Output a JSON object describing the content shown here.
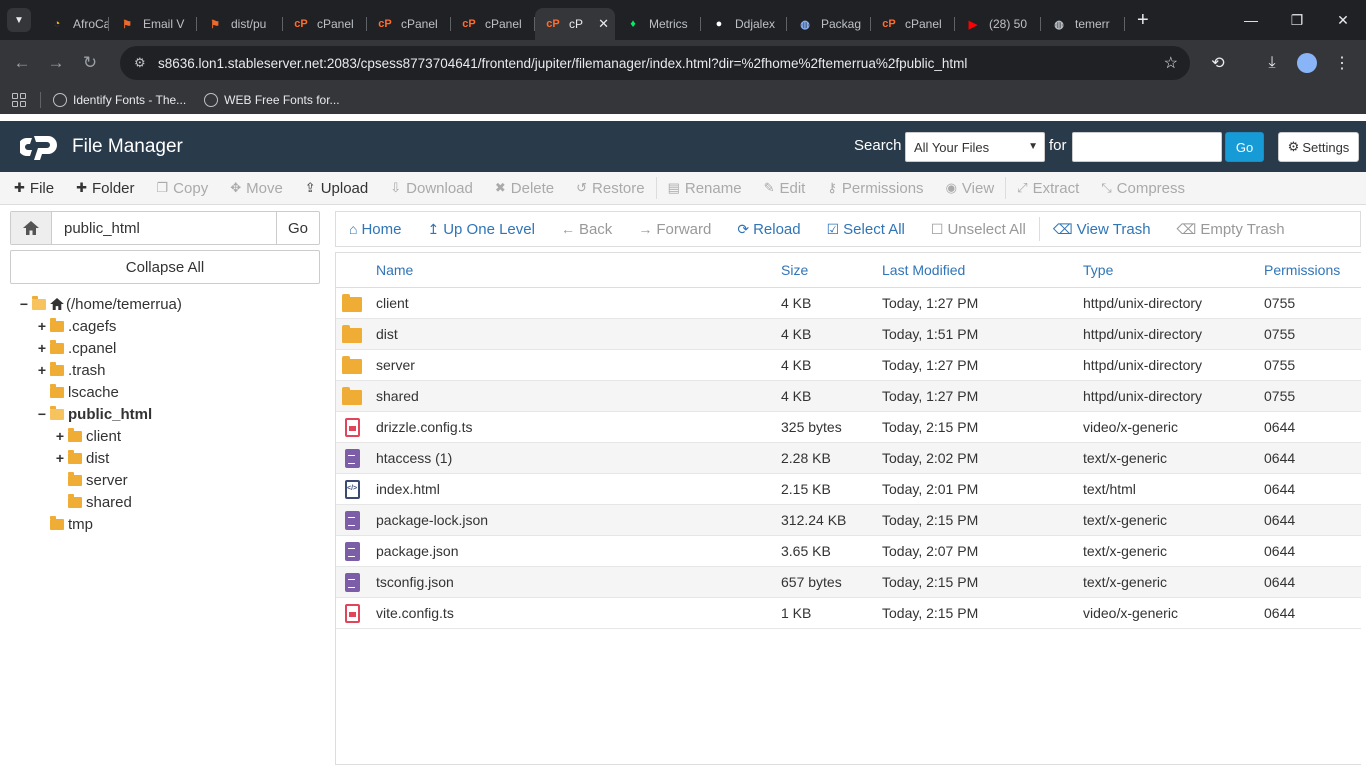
{
  "browser": {
    "tabs": [
      {
        "title": "AfroCa",
        "favicon": "afrocash-icon",
        "color": "#f5b400"
      },
      {
        "title": "Email V",
        "favicon": "git-icon",
        "color": "#f0692a"
      },
      {
        "title": "dist/pu",
        "favicon": "git-icon",
        "color": "#f0692a"
      },
      {
        "title": "cPanel",
        "favicon": "cpanel-icon",
        "color": "#ff6c2c"
      },
      {
        "title": "cPanel",
        "favicon": "cpanel-icon",
        "color": "#ff6c2c"
      },
      {
        "title": "cPanel",
        "favicon": "cpanel-icon",
        "color": "#ff6c2c"
      },
      {
        "title": "cP",
        "favicon": "cpanel-icon",
        "color": "#ff6c2c",
        "active": true
      },
      {
        "title": "Metrics",
        "favicon": "mongodb-leaf-icon",
        "color": "#00ed64"
      },
      {
        "title": "Ddjalex",
        "favicon": "github-icon",
        "color": "#ffffff"
      },
      {
        "title": "Packag",
        "favicon": "globe-icon",
        "color": "#8ab4f8"
      },
      {
        "title": "cPanel",
        "favicon": "cpanel-icon",
        "color": "#ff6c2c"
      },
      {
        "title": "(28) 50",
        "favicon": "youtube-icon",
        "color": "#ff0000"
      },
      {
        "title": "temerr",
        "favicon": "globe-icon",
        "color": "#bdc1c6"
      }
    ],
    "url": "s8636.lon1.stableserver.net:2083/cpsess8773704641/frontend/jupiter/filemanager/index.html?dir=%2fhome%2ftemerrua%2fpublic_html",
    "bookmarks": [
      {
        "label": "Identify Fonts - The..."
      },
      {
        "label": "WEB Free Fonts for..."
      }
    ]
  },
  "header": {
    "title": "File Manager",
    "search_label": "Search",
    "search_scope": "All Your Files",
    "for_label": "for",
    "search_value": "",
    "go_label": "Go",
    "settings_label": "Settings"
  },
  "actions": [
    {
      "label": "File",
      "icon": "plus-icon",
      "enabled": true
    },
    {
      "label": "Folder",
      "icon": "plus-icon",
      "enabled": true
    },
    {
      "label": "Copy",
      "icon": "copy-icon",
      "enabled": false
    },
    {
      "label": "Move",
      "icon": "move-icon",
      "enabled": false
    },
    {
      "label": "Upload",
      "icon": "upload-icon",
      "enabled": true
    },
    {
      "label": "Download",
      "icon": "download-icon",
      "enabled": false
    },
    {
      "label": "Delete",
      "icon": "delete-icon",
      "enabled": false
    },
    {
      "label": "Restore",
      "icon": "restore-icon",
      "enabled": false
    },
    {
      "label": "Rename",
      "icon": "rename-icon",
      "enabled": false
    },
    {
      "label": "Edit",
      "icon": "edit-icon",
      "enabled": false
    },
    {
      "label": "Permissions",
      "icon": "key-icon",
      "enabled": false
    },
    {
      "label": "View",
      "icon": "eye-icon",
      "enabled": false
    },
    {
      "label": "Extract",
      "icon": "extract-icon",
      "enabled": false
    },
    {
      "label": "Compress",
      "icon": "compress-icon",
      "enabled": false
    }
  ],
  "path": {
    "value": "public_html",
    "go_label": "Go",
    "collapse_label": "Collapse All"
  },
  "tree": [
    {
      "label": "(/home/temerrua)",
      "depth": 0,
      "toggle": "−",
      "open": true,
      "home": true
    },
    {
      "label": ".cagefs",
      "depth": 1,
      "toggle": "+"
    },
    {
      "label": ".cpanel",
      "depth": 1,
      "toggle": "+"
    },
    {
      "label": ".trash",
      "depth": 1,
      "toggle": "+"
    },
    {
      "label": "lscache",
      "depth": 1,
      "toggle": ""
    },
    {
      "label": "public_html",
      "depth": 1,
      "toggle": "−",
      "open": true,
      "bold": true
    },
    {
      "label": "client",
      "depth": 2,
      "toggle": "+"
    },
    {
      "label": "dist",
      "depth": 2,
      "toggle": "+"
    },
    {
      "label": "server",
      "depth": 2,
      "toggle": ""
    },
    {
      "label": "shared",
      "depth": 2,
      "toggle": ""
    },
    {
      "label": "tmp",
      "depth": 1,
      "toggle": ""
    }
  ],
  "nav": [
    {
      "label": "Home",
      "icon": "home-icon",
      "enabled": true
    },
    {
      "label": "Up One Level",
      "icon": "up-level-icon",
      "enabled": true
    },
    {
      "label": "Back",
      "icon": "back-arrow-icon",
      "enabled": false
    },
    {
      "label": "Forward",
      "icon": "forward-arrow-icon",
      "enabled": false
    },
    {
      "label": "Reload",
      "icon": "reload-icon",
      "enabled": true
    },
    {
      "label": "Select All",
      "icon": "checked-box-icon",
      "enabled": true
    },
    {
      "label": "Unselect All",
      "icon": "empty-box-icon",
      "enabled": false
    },
    {
      "label": "View Trash",
      "icon": "trash-icon",
      "enabled": true
    },
    {
      "label": "Empty Trash",
      "icon": "trash-icon",
      "enabled": false
    }
  ],
  "table": {
    "columns": [
      "Name",
      "Size",
      "Last Modified",
      "Type",
      "Permissions"
    ],
    "rows": [
      {
        "icon": "folder",
        "name": "client",
        "size": "4 KB",
        "modified": "Today, 1:27 PM",
        "type": "httpd/unix-directory",
        "perms": "0755"
      },
      {
        "icon": "folder",
        "name": "dist",
        "size": "4 KB",
        "modified": "Today, 1:51 PM",
        "type": "httpd/unix-directory",
        "perms": "0755"
      },
      {
        "icon": "folder",
        "name": "server",
        "size": "4 KB",
        "modified": "Today, 1:27 PM",
        "type": "httpd/unix-directory",
        "perms": "0755"
      },
      {
        "icon": "folder",
        "name": "shared",
        "size": "4 KB",
        "modified": "Today, 1:27 PM",
        "type": "httpd/unix-directory",
        "perms": "0755"
      },
      {
        "icon": "video",
        "name": "drizzle.config.ts",
        "size": "325 bytes",
        "modified": "Today, 2:15 PM",
        "type": "video/x-generic",
        "perms": "0644"
      },
      {
        "icon": "text",
        "name": "htaccess (1)",
        "size": "2.28 KB",
        "modified": "Today, 2:02 PM",
        "type": "text/x-generic",
        "perms": "0644"
      },
      {
        "icon": "html",
        "name": "index.html",
        "size": "2.15 KB",
        "modified": "Today, 2:01 PM",
        "type": "text/html",
        "perms": "0644"
      },
      {
        "icon": "text",
        "name": "package-lock.json",
        "size": "312.24 KB",
        "modified": "Today, 2:15 PM",
        "type": "text/x-generic",
        "perms": "0644"
      },
      {
        "icon": "text",
        "name": "package.json",
        "size": "3.65 KB",
        "modified": "Today, 2:07 PM",
        "type": "text/x-generic",
        "perms": "0644"
      },
      {
        "icon": "text",
        "name": "tsconfig.json",
        "size": "657 bytes",
        "modified": "Today, 2:15 PM",
        "type": "text/x-generic",
        "perms": "0644"
      },
      {
        "icon": "video",
        "name": "vite.config.ts",
        "size": "1 KB",
        "modified": "Today, 2:15 PM",
        "type": "video/x-generic",
        "perms": "0644"
      }
    ]
  },
  "colors": {
    "cpanel_header": "#293a4a",
    "link": "#3075b7",
    "go_button": "#179bd7",
    "folder": "#f0ad35"
  }
}
